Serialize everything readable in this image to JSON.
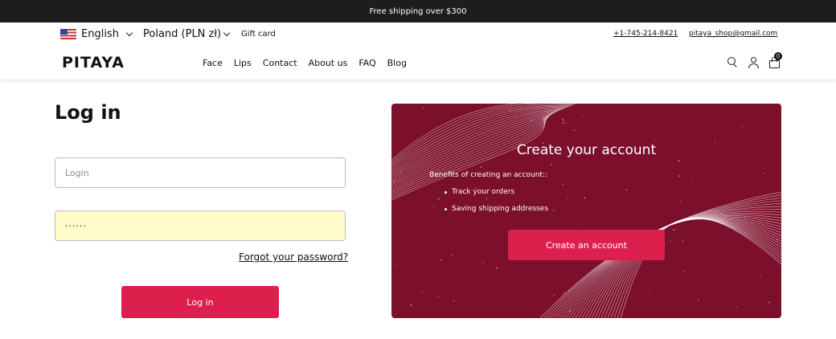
{
  "promo_bar": {
    "text": "Free shipping over $300"
  },
  "topbar": {
    "language": "English",
    "currency": "Poland (PLN zł)",
    "gift_card": "Gift card",
    "phone": "+1-745-214-8421",
    "email": "pitaya_shop@gmail.com",
    "flag_icon": "us-flag-icon"
  },
  "header": {
    "logo": "PITAYA",
    "nav": [
      "Face",
      "Lips",
      "Contact",
      "About us",
      "FAQ",
      "Blog"
    ],
    "icons": [
      "search-icon",
      "user-icon",
      "bag-icon"
    ],
    "cart_count": "0"
  },
  "login": {
    "title": "Log in",
    "login_placeholder": "Login",
    "password_value": "······",
    "forgot": "Forgot your password?",
    "button": "Log in"
  },
  "create_account": {
    "title": "Create your account",
    "benefits_title": "Benefits of creating an account::",
    "benefits": [
      "Track your orders",
      "Saving shipping addresses"
    ],
    "button": "Create an account"
  },
  "colors": {
    "accent": "#dd1f4e",
    "card_bg": "#7c0f2b",
    "autofill_bg": "#fefcc8",
    "promo_bar_bg": "#1d1d1d"
  }
}
